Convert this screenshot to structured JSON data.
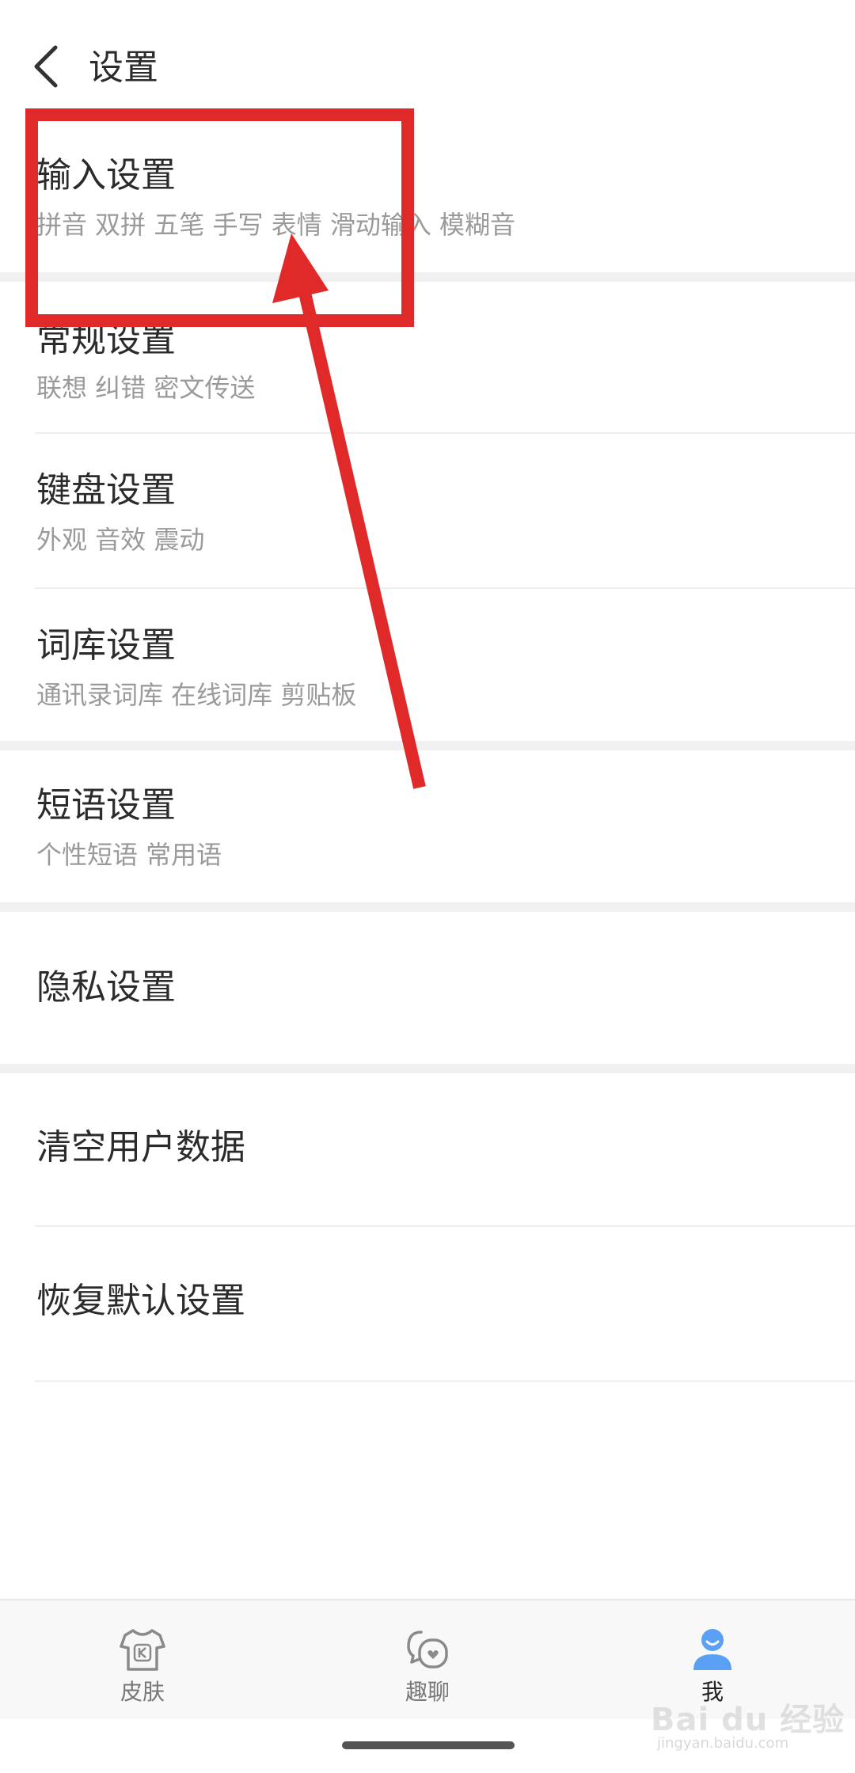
{
  "header": {
    "back_icon": "chevron-left-icon",
    "title": "设置"
  },
  "settings": [
    {
      "title": "输入设置",
      "subtitle": "拼音 双拼 五笔 手写 表情 滑动输入 模糊音"
    },
    {
      "title": "常规设置",
      "subtitle": "联想 纠错 密文传送"
    },
    {
      "title": "键盘设置",
      "subtitle": "外观 音效 震动"
    },
    {
      "title": "词库设置",
      "subtitle": "通讯录词库 在线词库 剪贴板"
    },
    {
      "title": "短语设置",
      "subtitle": "个性短语 常用语"
    },
    {
      "title": "隐私设置"
    },
    {
      "title": "清空用户数据"
    },
    {
      "title": "恢复默认设置"
    }
  ],
  "tabbar": {
    "tabs": [
      {
        "label": "皮肤",
        "icon": "tshirt-icon"
      },
      {
        "label": "趣聊",
        "icon": "chat-bubbles-icon"
      },
      {
        "label": "我",
        "icon": "user-icon",
        "active": true
      }
    ],
    "active_color": "#5aa0f5",
    "inactive_color": "#777777"
  },
  "annotation": {
    "color": "#e02a2a"
  },
  "watermark": {
    "text": "Bai du 经验",
    "url": "jingyan.baidu.com"
  }
}
